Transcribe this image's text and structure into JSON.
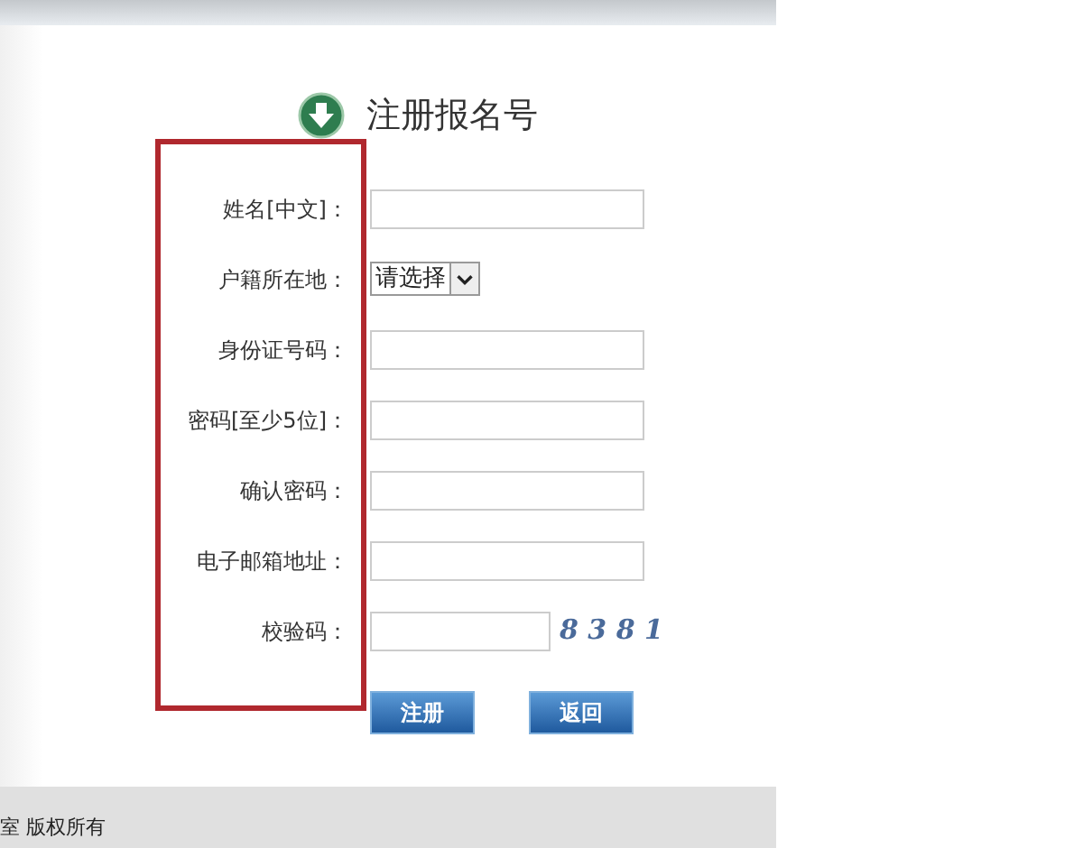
{
  "heading": "注册报名号",
  "fields": [
    {
      "kind": "text",
      "label": "姓名[中文]："
    },
    {
      "kind": "select",
      "label": "户籍所在地：",
      "value": "请选择"
    },
    {
      "kind": "text",
      "label": "身份证号码："
    },
    {
      "kind": "text",
      "label": "密码[至少5位]："
    },
    {
      "kind": "text",
      "label": "确认密码："
    },
    {
      "kind": "text",
      "label": "电子邮箱地址："
    },
    {
      "kind": "captcha",
      "label": "校验码：",
      "code": "8 3 8 1"
    }
  ],
  "buttons": [
    "注册",
    "返回"
  ],
  "footer": "室 版权所有"
}
